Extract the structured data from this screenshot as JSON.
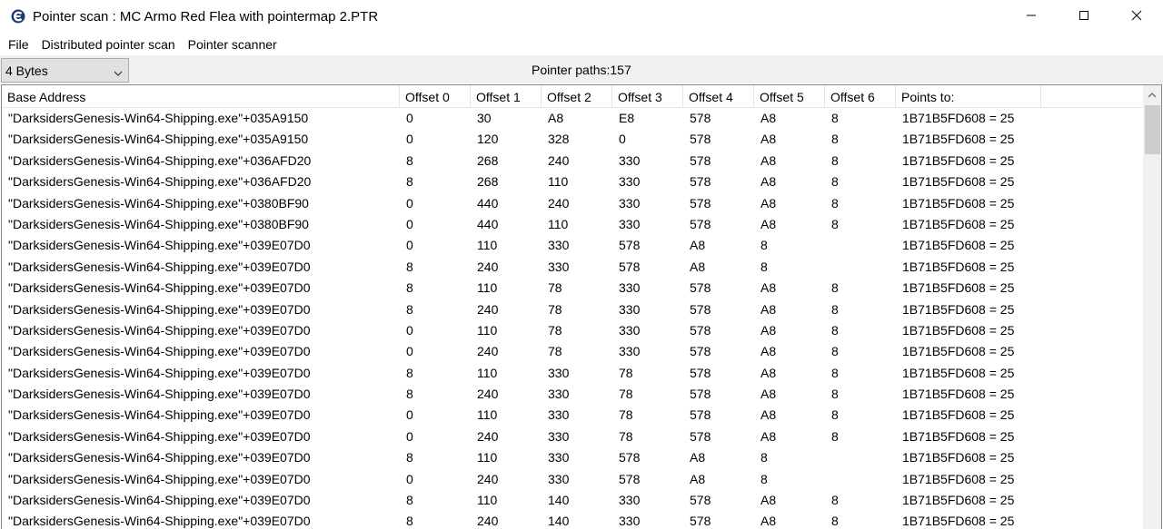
{
  "window": {
    "title": "Pointer scan : MC Armo Red Flea with pointermap 2.PTR",
    "icon": "cheat-engine-icon",
    "controls": [
      "minimize-icon",
      "maximize-icon",
      "close-icon"
    ]
  },
  "menu": {
    "items": [
      "File",
      "Distributed pointer scan",
      "Pointer scanner"
    ]
  },
  "toolbar": {
    "value_type": "4 Bytes",
    "pointer_paths": "Pointer paths:157"
  },
  "table": {
    "columns": [
      "Base Address",
      "Offset 0",
      "Offset 1",
      "Offset 2",
      "Offset 3",
      "Offset 4",
      "Offset 5",
      "Offset 6",
      "Points to:"
    ],
    "rows": [
      [
        "\"DarksidersGenesis-Win64-Shipping.exe\"+035A9150",
        "0",
        "30",
        "A8",
        "E8",
        "578",
        "A8",
        "8",
        "1B71B5FD608 = 25"
      ],
      [
        "\"DarksidersGenesis-Win64-Shipping.exe\"+035A9150",
        "0",
        "120",
        "328",
        "0",
        "578",
        "A8",
        "8",
        "1B71B5FD608 = 25"
      ],
      [
        "\"DarksidersGenesis-Win64-Shipping.exe\"+036AFD20",
        "8",
        "268",
        "240",
        "330",
        "578",
        "A8",
        "8",
        "1B71B5FD608 = 25"
      ],
      [
        "\"DarksidersGenesis-Win64-Shipping.exe\"+036AFD20",
        "8",
        "268",
        "110",
        "330",
        "578",
        "A8",
        "8",
        "1B71B5FD608 = 25"
      ],
      [
        "\"DarksidersGenesis-Win64-Shipping.exe\"+0380BF90",
        "0",
        "440",
        "240",
        "330",
        "578",
        "A8",
        "8",
        "1B71B5FD608 = 25"
      ],
      [
        "\"DarksidersGenesis-Win64-Shipping.exe\"+0380BF90",
        "0",
        "440",
        "110",
        "330",
        "578",
        "A8",
        "8",
        "1B71B5FD608 = 25"
      ],
      [
        "\"DarksidersGenesis-Win64-Shipping.exe\"+039E07D0",
        "0",
        "110",
        "330",
        "578",
        "A8",
        "8",
        "",
        "1B71B5FD608 = 25"
      ],
      [
        "\"DarksidersGenesis-Win64-Shipping.exe\"+039E07D0",
        "8",
        "240",
        "330",
        "578",
        "A8",
        "8",
        "",
        "1B71B5FD608 = 25"
      ],
      [
        "\"DarksidersGenesis-Win64-Shipping.exe\"+039E07D0",
        "8",
        "110",
        "78",
        "330",
        "578",
        "A8",
        "8",
        "1B71B5FD608 = 25"
      ],
      [
        "\"DarksidersGenesis-Win64-Shipping.exe\"+039E07D0",
        "8",
        "240",
        "78",
        "330",
        "578",
        "A8",
        "8",
        "1B71B5FD608 = 25"
      ],
      [
        "\"DarksidersGenesis-Win64-Shipping.exe\"+039E07D0",
        "0",
        "110",
        "78",
        "330",
        "578",
        "A8",
        "8",
        "1B71B5FD608 = 25"
      ],
      [
        "\"DarksidersGenesis-Win64-Shipping.exe\"+039E07D0",
        "0",
        "240",
        "78",
        "330",
        "578",
        "A8",
        "8",
        "1B71B5FD608 = 25"
      ],
      [
        "\"DarksidersGenesis-Win64-Shipping.exe\"+039E07D0",
        "8",
        "110",
        "330",
        "78",
        "578",
        "A8",
        "8",
        "1B71B5FD608 = 25"
      ],
      [
        "\"DarksidersGenesis-Win64-Shipping.exe\"+039E07D0",
        "8",
        "240",
        "330",
        "78",
        "578",
        "A8",
        "8",
        "1B71B5FD608 = 25"
      ],
      [
        "\"DarksidersGenesis-Win64-Shipping.exe\"+039E07D0",
        "0",
        "110",
        "330",
        "78",
        "578",
        "A8",
        "8",
        "1B71B5FD608 = 25"
      ],
      [
        "\"DarksidersGenesis-Win64-Shipping.exe\"+039E07D0",
        "0",
        "240",
        "330",
        "78",
        "578",
        "A8",
        "8",
        "1B71B5FD608 = 25"
      ],
      [
        "\"DarksidersGenesis-Win64-Shipping.exe\"+039E07D0",
        "8",
        "110",
        "330",
        "578",
        "A8",
        "8",
        "",
        "1B71B5FD608 = 25"
      ],
      [
        "\"DarksidersGenesis-Win64-Shipping.exe\"+039E07D0",
        "0",
        "240",
        "330",
        "578",
        "A8",
        "8",
        "",
        "1B71B5FD608 = 25"
      ],
      [
        "\"DarksidersGenesis-Win64-Shipping.exe\"+039E07D0",
        "8",
        "110",
        "140",
        "330",
        "578",
        "A8",
        "8",
        "1B71B5FD608 = 25"
      ],
      [
        "\"DarksidersGenesis-Win64-Shipping.exe\"+039E07D0",
        "8",
        "240",
        "140",
        "330",
        "578",
        "A8",
        "8",
        "1B71B5FD608 = 25"
      ]
    ]
  },
  "scrollbar": {
    "icon": "scroll-up-arrow-icon"
  }
}
